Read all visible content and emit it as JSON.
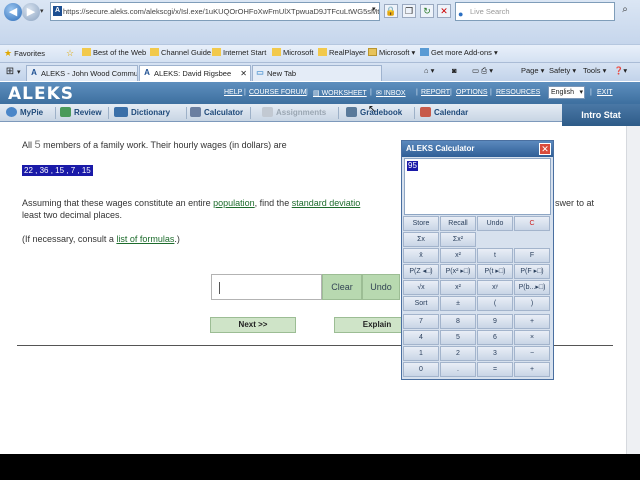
{
  "browser": {
    "url": "https://secure.aleks.com/alekscgi/x/Isl.exe/1uKUQOrOHFoXwFmUlXTpwuaD9JTFcuLtWG5sMtnitL7034",
    "search_placeholder": "Live Search",
    "favorites_label": "Favorites",
    "favorites": [
      "Best of the Web",
      "Channel Guide",
      "Internet Start",
      "Microsoft",
      "RealPlayer",
      "Microsoft",
      "Get more Add-ons"
    ],
    "tabs": [
      "ALEKS - John Wood Communi...",
      "ALEKS: David Rigsbee",
      "New Tab"
    ],
    "tools": [
      "Page",
      "Safety",
      "Tools"
    ]
  },
  "aleks": {
    "logo": "ALEKS",
    "top_links": [
      "HELP",
      "COURSE FORUM",
      "WORKSHEET",
      "INBOX",
      "REPORT",
      "OPTIONS",
      "RESOURCES",
      "EXIT"
    ],
    "language": "English",
    "nav": [
      "MyPie",
      "Review",
      "Dictionary",
      "Calculator",
      "Assignments",
      "Gradebook",
      "Calendar"
    ],
    "course": "Intro Stat"
  },
  "problem": {
    "line1_pre": "All",
    "line1_num": "5",
    "line1_post": "members of a family work. Their hourly wages (in dollars) are",
    "data": "22 , 36 , 15 , 7 , 15",
    "line2_pre": "Assuming that these wages constitute an entire",
    "line2_link1": "population",
    "line2_mid": ", find the",
    "line2_link2": "standard deviatio",
    "line2_tail": "swer to at",
    "line3": "least two decimal places.",
    "line4_pre": "(If necessary, consult a",
    "line4_link": "list of formulas",
    "line4_post": ".)",
    "answer_value": "",
    "clear_label": "Clear",
    "undo_label": "Undo",
    "next_label": "Next >>",
    "explain_label": "Explain"
  },
  "calculator": {
    "title": "ALEKS Calculator",
    "display": "95",
    "row1": [
      "Store",
      "Recall",
      "Undo",
      "C"
    ],
    "row2": [
      "Σx",
      "Σx²"
    ],
    "row3": [
      "x̄",
      "x²",
      "t",
      "F"
    ],
    "row4": [
      "P(Z ◂□)",
      "P(x² ▸□)",
      "P(t ▸□)",
      "P(F ▸□)"
    ],
    "row5": [
      "√x",
      "x²",
      "xʸ",
      "P(b...▸□)"
    ],
    "row6": [
      "Sort",
      "±",
      "(",
      ")"
    ],
    "row7": [
      "7",
      "8",
      "9",
      "+"
    ],
    "row8": [
      "4",
      "5",
      "6",
      "×"
    ],
    "row9": [
      "1",
      "2",
      "3",
      "−"
    ],
    "row10": [
      "0",
      ".",
      "=",
      "+"
    ]
  }
}
